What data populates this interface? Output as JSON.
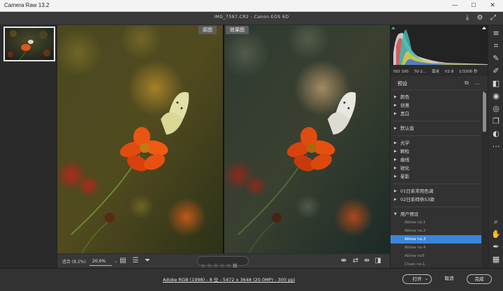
{
  "window": {
    "title": "Camera Raw 13.2",
    "minimize": "—",
    "maximize": "☐",
    "close": "✕"
  },
  "infobar": {
    "file": "IMG_7597.CR2 -  Canon EOS 6D"
  },
  "viewer": {
    "before_label": "原图",
    "after_label": "效果图"
  },
  "viewbar": {
    "fit_label": "适合 (8.2%)",
    "zoom_value": "20.0%"
  },
  "histogram": {
    "iso": "ISO 100",
    "lens": "70-2...",
    "focal": "毫米",
    "aperture": "f/2.8",
    "shutter": "1/3200 秒"
  },
  "presets": {
    "header": "预设",
    "groups": [
      {
        "label": "颜色"
      },
      {
        "label": "创意"
      },
      {
        "label": "黑白"
      },
      {
        "label": "默认值"
      },
      {
        "label": "光学"
      },
      {
        "label": "颗粒"
      },
      {
        "label": "曲线"
      },
      {
        "label": "锐化"
      },
      {
        "label": "晕影"
      },
      {
        "label": "01日系常用色调"
      },
      {
        "label": "02日系特供S3款"
      },
      {
        "label": "用户预设"
      }
    ],
    "user_items": [
      "Ablow no.1",
      "Ablow no.2",
      "Ablow no.3",
      "Ablow no.4",
      "Ablow no5",
      "Clean no.1"
    ],
    "selected": "Ablow no.3"
  },
  "footer": {
    "metadata": "Adobe RGB (1998) - 8 位 - 5472 x 3648 (20.0MP) - 300 ppi",
    "open_label": "打开",
    "cancel_label": "取消",
    "done_label": "完成"
  },
  "colors": {
    "accent": "#3b86d8",
    "panel": "#323232",
    "titlebar": "#f3f3f3"
  },
  "icons": [
    "save-icon",
    "gear-icon",
    "fullscreen-icon",
    "sliders-icon",
    "crop-icon",
    "brush-icon",
    "heal-icon",
    "gradient-icon",
    "radial-icon",
    "redeye-icon",
    "snapshot-icon",
    "presets-icon",
    "more-icon",
    "zoom-icon",
    "hand-icon",
    "sampler-icon",
    "grid-icon"
  ]
}
